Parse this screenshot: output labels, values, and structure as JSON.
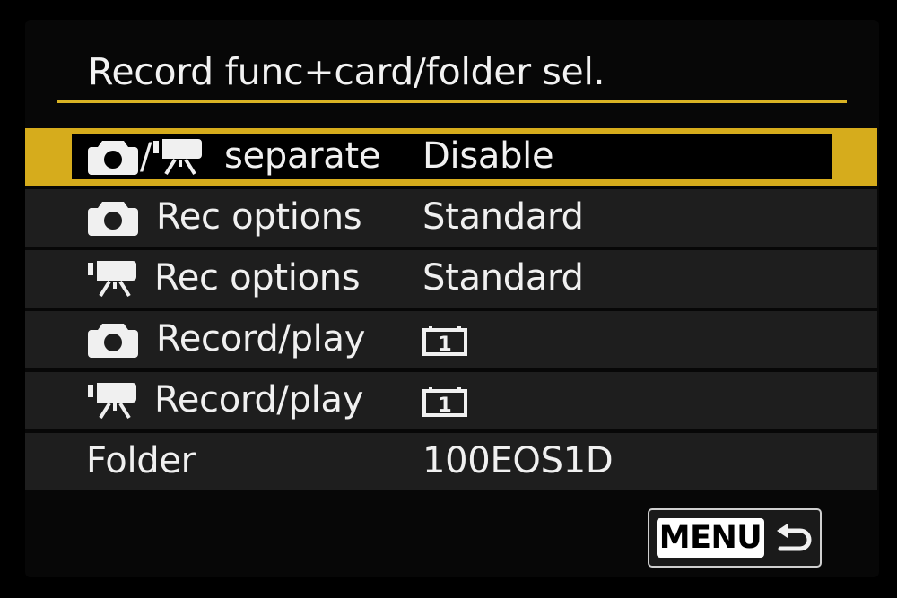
{
  "title": "Record func+card/folder sel.",
  "rows": [
    {
      "label": "separate",
      "value": "Disable",
      "icons": [
        "camera-icon",
        "slash",
        "movie-camera-icon"
      ],
      "selected": true
    },
    {
      "label": "Rec options",
      "value": "Standard",
      "icons": [
        "camera-icon"
      ]
    },
    {
      "label": "Rec options",
      "value": "Standard",
      "icons": [
        "movie-camera-icon"
      ]
    },
    {
      "label": "Record/play",
      "value": "",
      "value_icon": "card-slot-1-icon",
      "value_icon_text": "1",
      "icons": [
        "camera-icon"
      ]
    },
    {
      "label": "Record/play",
      "value": "",
      "value_icon": "card-slot-1-icon",
      "value_icon_text": "1",
      "icons": [
        "movie-camera-icon"
      ]
    },
    {
      "label": "Folder",
      "value": "100EOS1D",
      "icons": []
    }
  ],
  "separator": "/",
  "menu_button": {
    "label": "MENU",
    "icon": "return-arrow-icon"
  },
  "colors": {
    "accent": "#d6ac1c",
    "row_bg": "#1e1e1e",
    "text": "#f0f0f0",
    "background": "#000000"
  }
}
